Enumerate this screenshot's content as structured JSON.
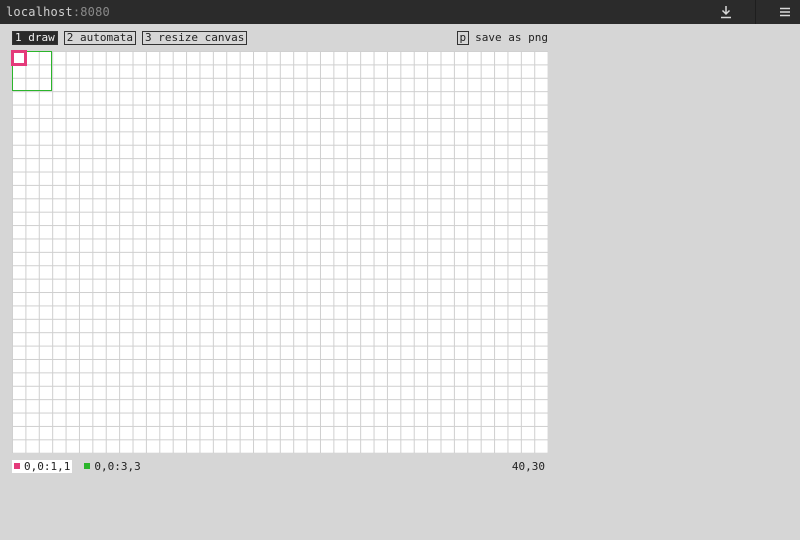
{
  "browser": {
    "host": "localhost",
    "port": ":8080"
  },
  "icons": {
    "download": "download-icon",
    "menu": "hamburger-menu-icon"
  },
  "tabs": [
    {
      "label": "1 draw",
      "active": true
    },
    {
      "label": "2 automata",
      "active": false
    },
    {
      "label": "3 resize canvas",
      "active": false
    }
  ],
  "save": {
    "key": "p",
    "label": "save as png"
  },
  "status": {
    "primary": "0,0:1,1",
    "secondary": "0,0:3,3",
    "dimensions": "40,30"
  },
  "colors": {
    "primary_selection": "#e43a7a",
    "secondary_selection": "#2bb52b"
  }
}
